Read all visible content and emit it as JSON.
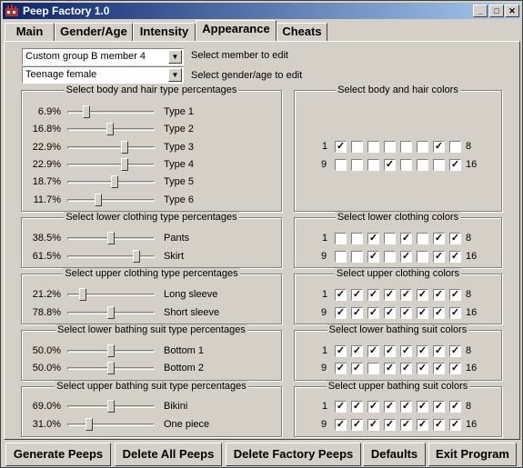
{
  "window": {
    "title": "Peep Factory 1.0",
    "controls": [
      "_",
      "□",
      "✕"
    ]
  },
  "tabs": [
    {
      "label": "Main",
      "active": false
    },
    {
      "label": "Gender/Age",
      "active": false
    },
    {
      "label": "Intensity",
      "active": false
    },
    {
      "label": "Appearance",
      "active": true
    },
    {
      "label": "Cheats",
      "active": false
    }
  ],
  "member_select": {
    "value": "Custom group B member 4",
    "label": "Select member to edit"
  },
  "gender_select": {
    "value": "Teenage female",
    "label": "Select gender/age to edit"
  },
  "type_groups": [
    {
      "title": "Select body and hair type percentages",
      "rows": [
        {
          "pct": "6.9%",
          "name": "Type 1",
          "level": 0.22
        },
        {
          "pct": "16.8%",
          "name": "Type 2",
          "level": 0.49
        },
        {
          "pct": "22.9%",
          "name": "Type 3",
          "level": 0.66
        },
        {
          "pct": "22.9%",
          "name": "Type 4",
          "level": 0.66
        },
        {
          "pct": "18.7%",
          "name": "Type 5",
          "level": 0.54
        },
        {
          "pct": "11.7%",
          "name": "Type 6",
          "level": 0.35
        }
      ]
    },
    {
      "title": "Select lower clothing type percentages",
      "rows": [
        {
          "pct": "38.5%",
          "name": "Pants",
          "level": 0.5
        },
        {
          "pct": "61.5%",
          "name": "Skirt",
          "level": 0.79
        }
      ]
    },
    {
      "title": "Select upper clothing type percentages",
      "rows": [
        {
          "pct": "21.2%",
          "name": "Long sleeve",
          "level": 0.18
        },
        {
          "pct": "78.8%",
          "name": "Short sleeve",
          "level": 0.5
        }
      ]
    },
    {
      "title": "Select lower bathing suit type percentages",
      "rows": [
        {
          "pct": "50.0%",
          "name": "Bottom 1",
          "level": 0.5
        },
        {
          "pct": "50.0%",
          "name": "Bottom 2",
          "level": 0.5
        }
      ]
    },
    {
      "title": "Select upper bathing suit type percentages",
      "rows": [
        {
          "pct": "69.0%",
          "name": "Bikini",
          "level": 0.5
        },
        {
          "pct": "31.0%",
          "name": "One piece",
          "level": 0.25
        }
      ]
    }
  ],
  "color_groups": [
    {
      "title": "Select body and hair colors",
      "row1_start": "1",
      "row1_end": "8",
      "row2_start": "9",
      "row2_end": "16",
      "row1": [
        true,
        false,
        false,
        false,
        false,
        false,
        true,
        false
      ],
      "row2": [
        false,
        false,
        false,
        true,
        false,
        false,
        false,
        true
      ]
    },
    {
      "title": "Select lower clothing colors",
      "row1_start": "1",
      "row1_end": "8",
      "row2_start": "9",
      "row2_end": "16",
      "row1": [
        false,
        false,
        true,
        false,
        true,
        false,
        true,
        true
      ],
      "row2": [
        false,
        false,
        true,
        false,
        true,
        false,
        true,
        true
      ]
    },
    {
      "title": "Select upper clothing colors",
      "row1_start": "1",
      "row1_end": "8",
      "row2_start": "9",
      "row2_end": "16",
      "row1": [
        true,
        true,
        true,
        true,
        true,
        true,
        true,
        true
      ],
      "row2": [
        true,
        true,
        true,
        true,
        true,
        true,
        true,
        true
      ]
    },
    {
      "title": "Select lower bathing suit colors",
      "row1_start": "1",
      "row1_end": "8",
      "row2_start": "9",
      "row2_end": "16",
      "row1": [
        true,
        true,
        true,
        true,
        true,
        true,
        true,
        true
      ],
      "row2": [
        true,
        true,
        false,
        true,
        true,
        true,
        true,
        true
      ]
    },
    {
      "title": "Select upper bathing suit colors",
      "row1_start": "1",
      "row1_end": "8",
      "row2_start": "9",
      "row2_end": "16",
      "row1": [
        true,
        true,
        true,
        true,
        true,
        true,
        true,
        true
      ],
      "row2": [
        true,
        true,
        true,
        true,
        true,
        true,
        true,
        true
      ]
    }
  ],
  "buttons": {
    "generate": "Generate Peeps",
    "delete_all": "Delete All Peeps",
    "delete_factory": "Delete Factory Peeps",
    "defaults": "Defaults",
    "exit": "Exit Program"
  }
}
